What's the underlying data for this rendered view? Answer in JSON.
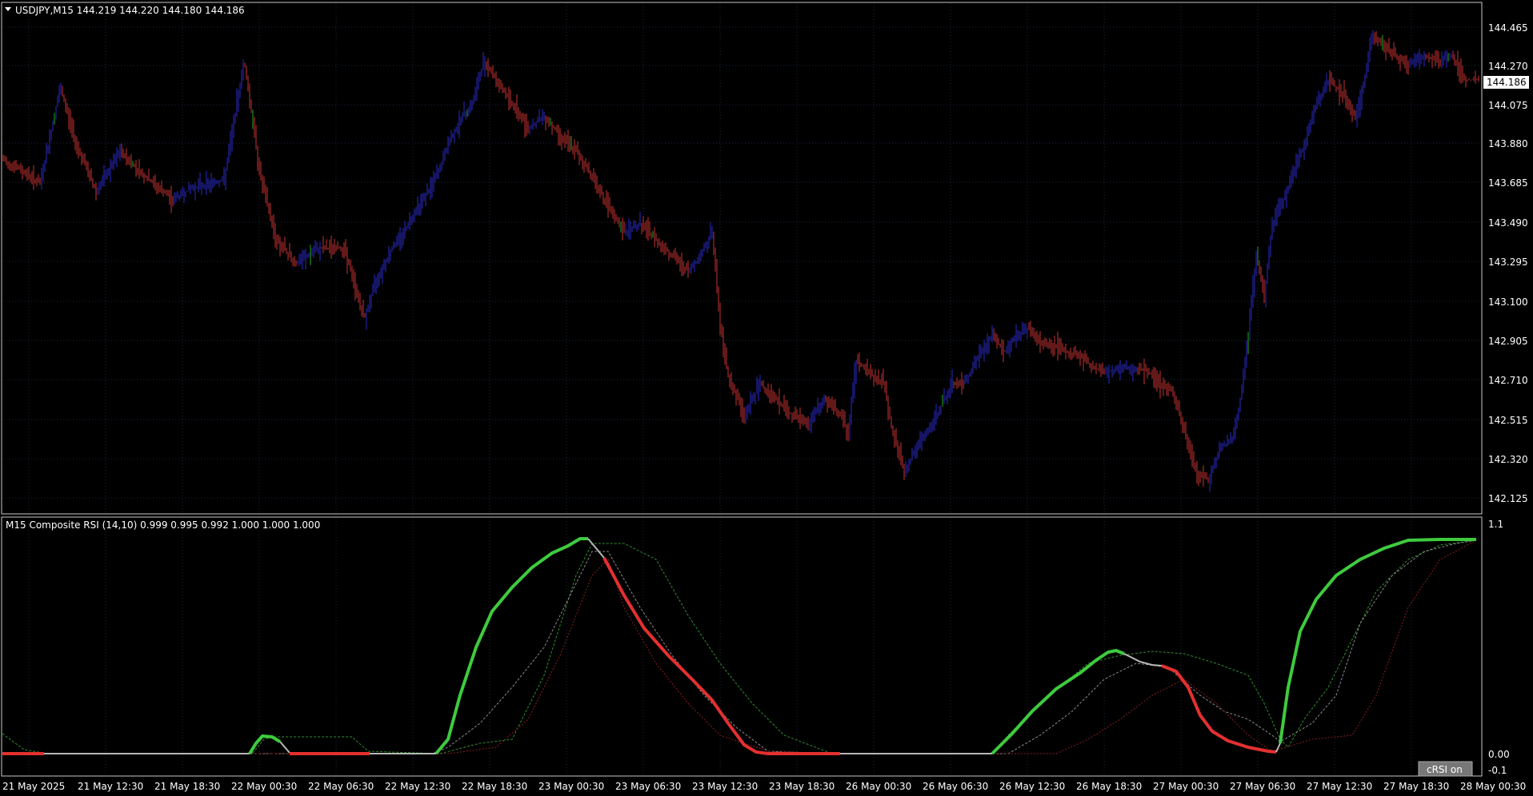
{
  "main_chart": {
    "title": "USDJPY,M15  144.219 144.220 144.180 144.186",
    "price_labels": [
      "144.465",
      "144.270",
      "144.075",
      "143.880",
      "143.685",
      "143.490",
      "143.295",
      "143.100",
      "142.905",
      "142.710",
      "142.515",
      "142.320",
      "142.125"
    ],
    "current_price": "144.186",
    "colors": {
      "up_bar": "#2a2ac8",
      "down_bar": "#c83232",
      "neutral_bar": "#22aa22",
      "grid": "#1c2742"
    }
  },
  "indicator": {
    "title": "M15 Composite RSI (14,10) 0.999 0.995 0.992 1.000 1.000 1.000",
    "scale_labels": [
      "1.1",
      "0.00",
      "-0.1"
    ],
    "button_label": "cRSI on",
    "colors": {
      "up": "#3ecb3e",
      "down": "#e43030",
      "neutral": "#b8b8b8",
      "dash_green": "#2f8f2f",
      "dash_red": "#8a1e1e",
      "dash_gray": "#8a8a8a"
    }
  },
  "time_labels": [
    "21 May 2025",
    "21 May 12:30",
    "21 May 18:30",
    "22 May 00:30",
    "22 May 06:30",
    "22 May 12:30",
    "22 May 18:30",
    "23 May 00:30",
    "23 May 06:30",
    "23 May 12:30",
    "23 May 18:30",
    "26 May 00:30",
    "26 May 06:30",
    "26 May 12:30",
    "26 May 18:30",
    "27 May 00:30",
    "27 May 06:30",
    "27 May 12:30",
    "27 May 18:30",
    "28 May 00:30"
  ]
}
